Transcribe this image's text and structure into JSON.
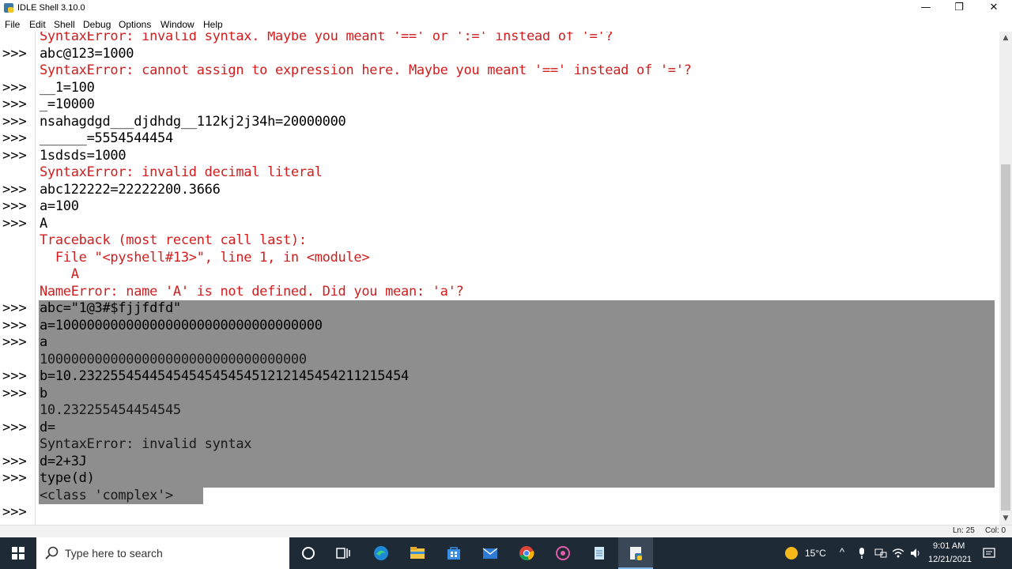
{
  "window": {
    "title": "IDLE Shell 3.10.0",
    "minimize_glyph": "—",
    "maximize_glyph": "❐",
    "close_glyph": "✕"
  },
  "menu": [
    {
      "label": "File"
    },
    {
      "label": "Edit"
    },
    {
      "label": "Shell"
    },
    {
      "label": "Debug"
    },
    {
      "label": "Options"
    },
    {
      "label": "Window"
    },
    {
      "label": "Help"
    }
  ],
  "shell": {
    "prompt": ">>>",
    "lines": [
      {
        "prompt": false,
        "kind": "err",
        "text": "SyntaxError: invalid syntax. Maybe you meant '==' or ':=' instead of '='?",
        "selected": false
      },
      {
        "prompt": true,
        "kind": "in",
        "text": "abc@123=1000",
        "selected": false
      },
      {
        "prompt": false,
        "kind": "err",
        "text": "SyntaxError: cannot assign to expression here. Maybe you meant '==' instead of '='?",
        "selected": false
      },
      {
        "prompt": true,
        "kind": "in",
        "text": "__1=100",
        "selected": false
      },
      {
        "prompt": true,
        "kind": "in",
        "text": "_=10000",
        "selected": false
      },
      {
        "prompt": true,
        "kind": "in",
        "text": "nsahagdgd___djdhdg__112kj2j34h=20000000",
        "selected": false
      },
      {
        "prompt": true,
        "kind": "in",
        "text": "______=5554544454",
        "selected": false
      },
      {
        "prompt": true,
        "kind": "in",
        "text": "1sdsds=1000",
        "selected": false
      },
      {
        "prompt": false,
        "kind": "err",
        "text": "SyntaxError: invalid decimal literal",
        "selected": false
      },
      {
        "prompt": true,
        "kind": "in",
        "text": "abc122222=22222200.3666",
        "selected": false
      },
      {
        "prompt": true,
        "kind": "in",
        "text": "a=100",
        "selected": false
      },
      {
        "prompt": true,
        "kind": "in",
        "text": "A",
        "selected": false
      },
      {
        "prompt": false,
        "kind": "err",
        "text": "Traceback (most recent call last):",
        "selected": false
      },
      {
        "prompt": false,
        "kind": "err",
        "text": "  File \"<pyshell#13>\", line 1, in <module>",
        "selected": false
      },
      {
        "prompt": false,
        "kind": "err",
        "text": "    A",
        "selected": false
      },
      {
        "prompt": false,
        "kind": "err",
        "text": "NameError: name 'A' is not defined. Did you mean: 'a'?",
        "selected": false
      },
      {
        "prompt": true,
        "kind": "in",
        "text": "abc=\"1@3#$fjjfdfd\"",
        "selected": true
      },
      {
        "prompt": true,
        "kind": "in",
        "text": "a=1000000000000000000000000000000000",
        "selected": true
      },
      {
        "prompt": true,
        "kind": "in",
        "text": "a",
        "selected": true
      },
      {
        "prompt": false,
        "kind": "out",
        "text": "1000000000000000000000000000000000",
        "selected": true
      },
      {
        "prompt": true,
        "kind": "in",
        "text": "b=10.232255454454545454545451212145454211215454",
        "selected": true
      },
      {
        "prompt": true,
        "kind": "in",
        "text": "b",
        "selected": true
      },
      {
        "prompt": false,
        "kind": "out",
        "text": "10.232255454454545",
        "selected": true
      },
      {
        "prompt": true,
        "kind": "in",
        "text": "d=",
        "selected": true
      },
      {
        "prompt": false,
        "kind": "out",
        "text": "SyntaxError: invalid syntax",
        "selected": true
      },
      {
        "prompt": true,
        "kind": "in",
        "text": "d=2+3J",
        "selected": true
      },
      {
        "prompt": true,
        "kind": "in",
        "text": "type(d)",
        "selected": true
      },
      {
        "prompt": false,
        "kind": "out",
        "text": "<class 'complex'>",
        "selected": "partial"
      },
      {
        "prompt": true,
        "kind": "in",
        "text": "",
        "selected": false
      }
    ]
  },
  "status": {
    "line": "Ln: 25",
    "col": "Col: 0"
  },
  "taskbar": {
    "search_placeholder": "Type here to search",
    "apps": [
      "task-view-icon",
      "edge-icon",
      "file-explorer-icon",
      "store-icon",
      "mail-icon",
      "chrome-icon",
      "app-icon",
      "notepad-icon",
      "idle-icon"
    ],
    "weather": "15°C",
    "time": "9:01 AM",
    "date": "12/21/2021"
  },
  "colors": {
    "error": "#d11d1d",
    "selection": "#8e8e8e",
    "taskbar": "#1f2a37"
  }
}
